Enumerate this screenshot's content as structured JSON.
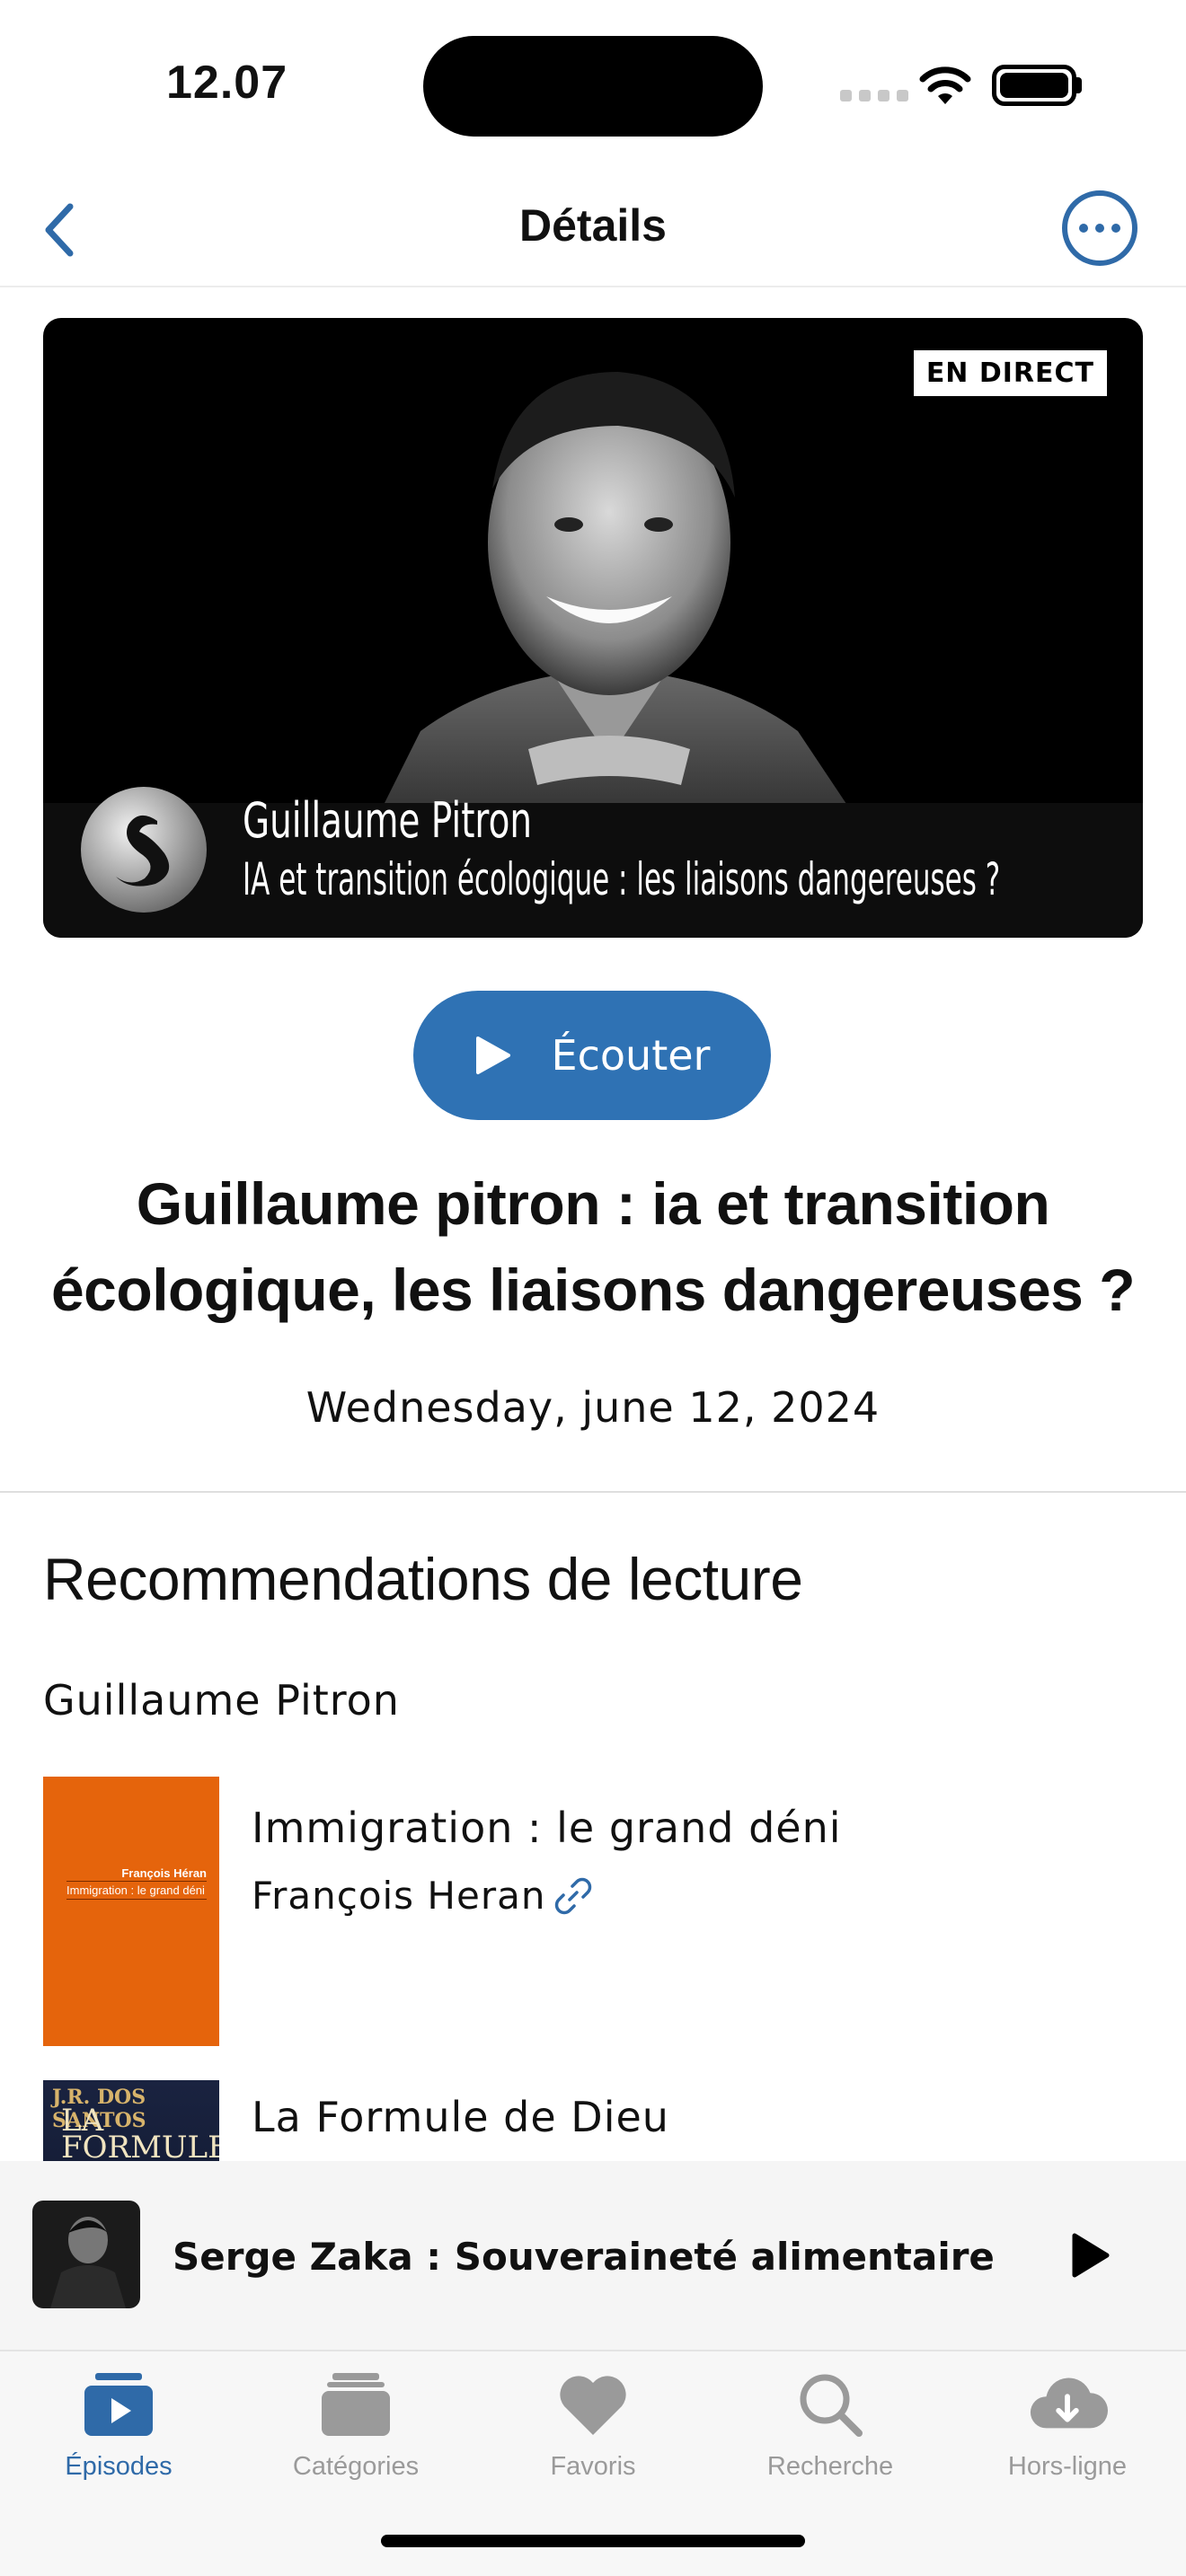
{
  "status_bar": {
    "time": "12.07"
  },
  "nav": {
    "title": "Détails"
  },
  "hero": {
    "badge": "EN DIRECT",
    "name": "Guillaume Pitron",
    "subtitle": "IA et transition écologique : les liaisons dangereuses ?"
  },
  "actions": {
    "listen_label": "Écouter"
  },
  "episode": {
    "title": "Guillaume pitron : ia et transition écologique, les liaisons dangereuses ?",
    "date": "Wednesday, june 12, 2024"
  },
  "recommendations": {
    "heading": "Recommendations de lecture",
    "author": "Guillaume Pitron",
    "books": [
      {
        "title": "Immigration : le grand déni",
        "author": "François Heran",
        "cover_author": "François Héran",
        "cover_title": "Immigration : le grand déni"
      },
      {
        "title": "La Formule de Dieu",
        "cover_author": "J.R. DOS SANTOS",
        "cover_title": "LA FORMULE DE DIEU"
      }
    ]
  },
  "mini_player": {
    "title": "Serge Zaka : Souveraineté alimentaire fac..."
  },
  "tabs": [
    {
      "label": "Épisodes",
      "icon": "play-stack-icon",
      "active": true
    },
    {
      "label": "Catégories",
      "icon": "stack-icon",
      "active": false
    },
    {
      "label": "Favoris",
      "icon": "heart-icon",
      "active": false
    },
    {
      "label": "Recherche",
      "icon": "search-icon",
      "active": false
    },
    {
      "label": "Hors-ligne",
      "icon": "cloud-download-icon",
      "active": false
    }
  ],
  "colors": {
    "accent": "#2f72b4",
    "tab_active": "#2f6aa8",
    "tab_inactive": "#9a9a9a"
  }
}
